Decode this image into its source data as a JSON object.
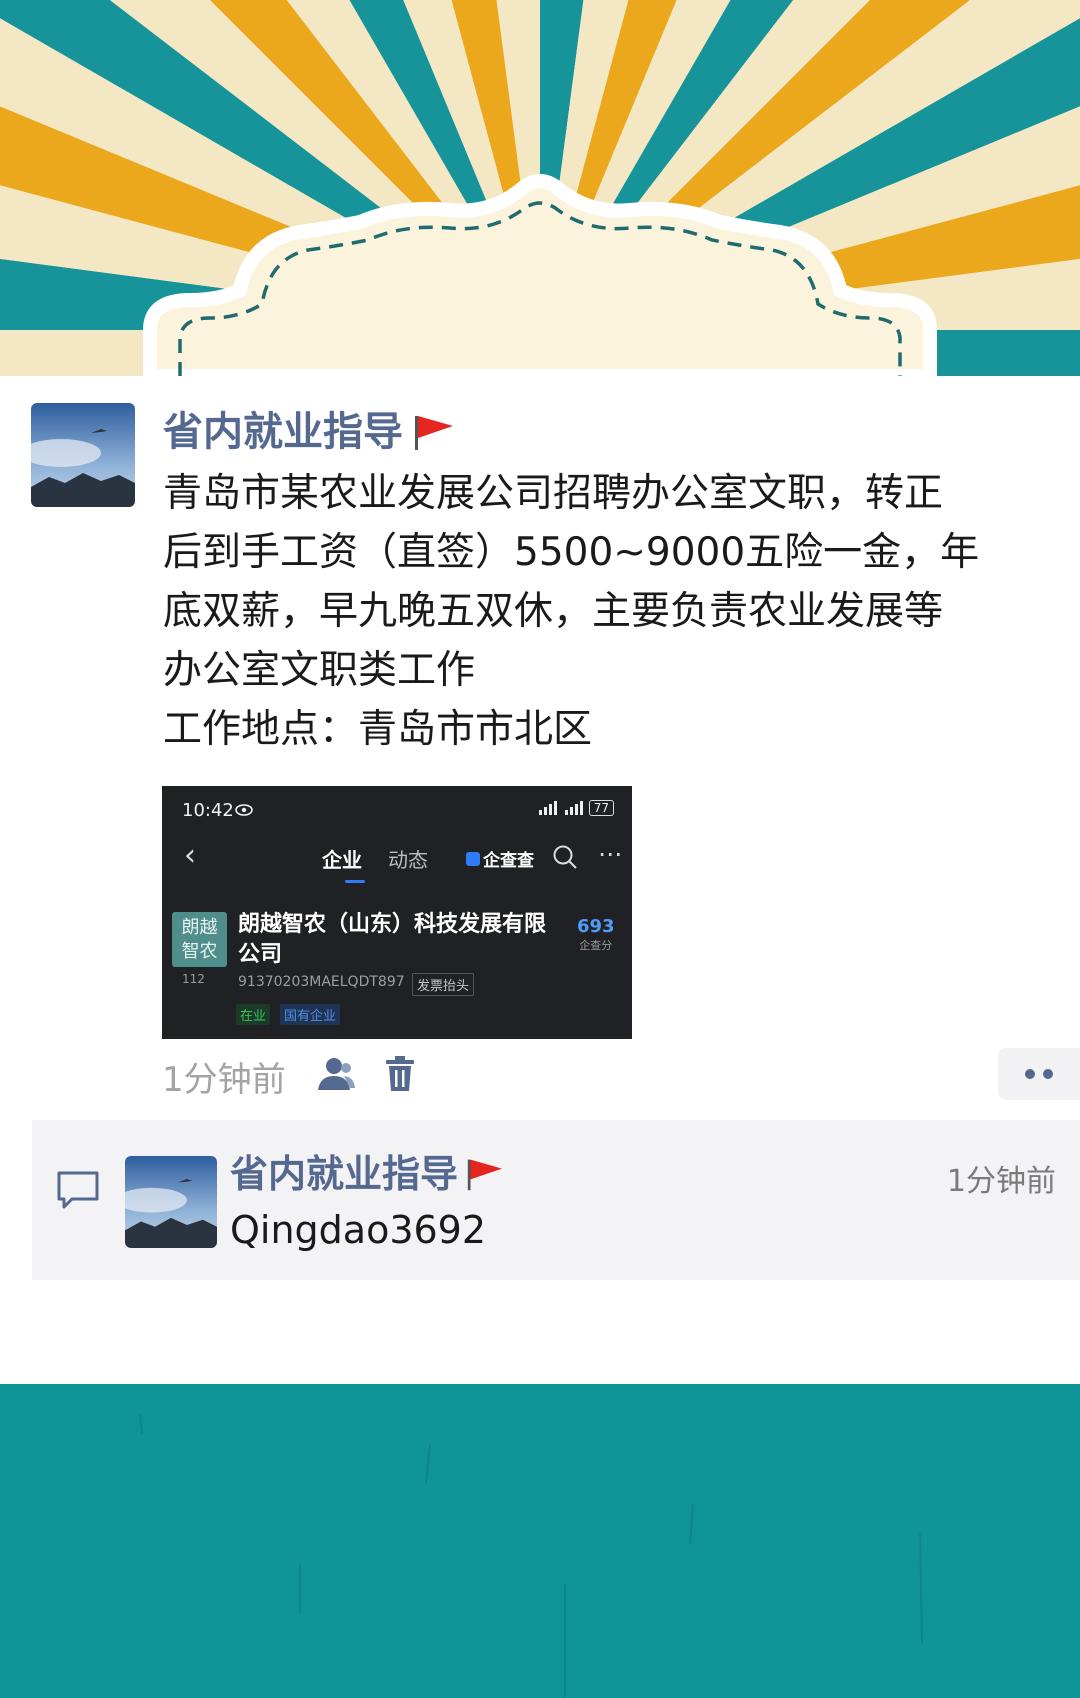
{
  "post": {
    "author": "省内就业指导",
    "body": "青岛市某农业发展公司招聘办公室文职，转正\n后到手工资（直签）5500~9000五险一金，年\n底双薪，早九晚五双休，主要负责农业发展等\n办公室文职类工作\n工作地点：青岛市市北区",
    "time": "1分钟前"
  },
  "attachment": {
    "status_time": "10:42",
    "battery": "77",
    "tab_company": "企业",
    "tab_news": "动态",
    "brand": "企查查",
    "logo_text": "朗越\n智农",
    "views": "112",
    "company_name": "朗越智农（山东）科技发展有限公司",
    "score": "693",
    "score_label": "企查分",
    "credit_code": "91370203MAELQDT897",
    "tag_invoice": "发票抬头",
    "tag_active": "在业",
    "tag_state": "国有企业"
  },
  "comment": {
    "author": "省内就业指导",
    "time": "1分钟前",
    "text": "Qingdao3692"
  },
  "colors": {
    "author": "#55688f",
    "footer": "#0f949a",
    "ray_teal": "#17939a",
    "ray_orange": "#eba81c",
    "ray_cream": "#f4e7c3"
  }
}
